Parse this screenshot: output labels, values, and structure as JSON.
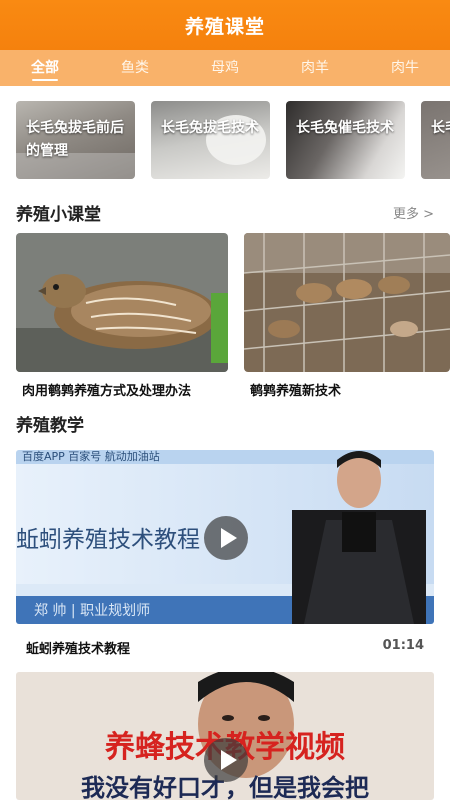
{
  "header": {
    "title": "养殖课堂"
  },
  "tabs": [
    {
      "label": "全部",
      "active": true
    },
    {
      "label": "鱼类",
      "active": false
    },
    {
      "label": "母鸡",
      "active": false
    },
    {
      "label": "肉羊",
      "active": false
    },
    {
      "label": "肉牛",
      "active": false
    }
  ],
  "banners": [
    {
      "text": "长毛兔拔毛前后的管理"
    },
    {
      "text": "长毛兔拔毛技术"
    },
    {
      "text": "长毛兔催毛技术"
    },
    {
      "text": "长毛兔养殖"
    }
  ],
  "classroom": {
    "title": "养殖小课堂",
    "more": "更多 >",
    "cards": [
      {
        "caption": "肉用鹌鹑养殖方式及处理办法"
      },
      {
        "caption": "鹌鹑养殖新技术"
      }
    ]
  },
  "teaching": {
    "title": "养殖教学",
    "videos": [
      {
        "overlay_top": "百度APP  百家号  航动加油站",
        "overlay_title": "蚯蚓养殖技术教程",
        "overlay_sub": "郑 帅  |  职业规划师",
        "caption": "蚯蚓养殖技术教程",
        "duration": "01:14"
      },
      {
        "overlay_title": "养蜂技术教学视频",
        "overlay_sub": "我没有好口才，但是我会把"
      }
    ]
  },
  "colors": {
    "brand": "#f5810d",
    "tabbar": "#f9b26a"
  }
}
